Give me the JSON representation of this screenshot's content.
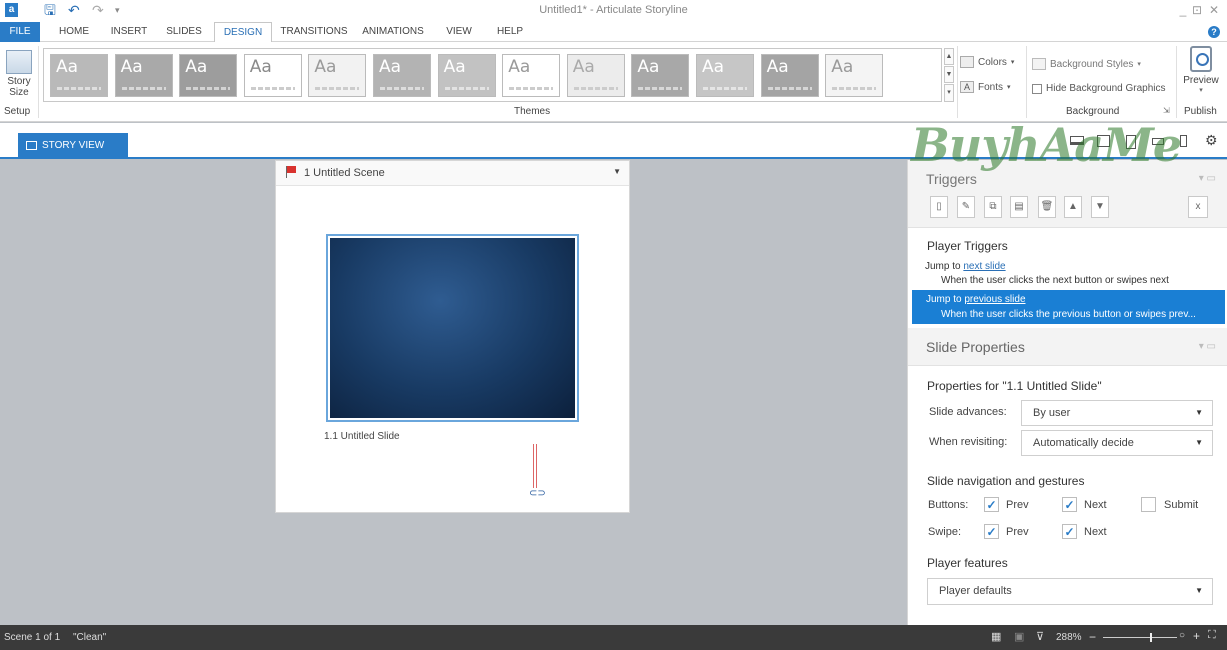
{
  "titlebar": {
    "app_icon": "a",
    "title": "Untitled1* - Articulate Storyline",
    "icons": [
      "save-icon",
      "undo-icon",
      "redo-icon",
      "customize-icon"
    ],
    "minimize": "_",
    "restore": "⊡",
    "close": "✕"
  },
  "tabs": [
    "FILE",
    "HOME",
    "INSERT",
    "SLIDES",
    "DESIGN",
    "TRANSITIONS",
    "ANIMATIONS",
    "VIEW",
    "HELP"
  ],
  "active_tab": "DESIGN",
  "help": "?",
  "ribbon": {
    "story_size": {
      "line1": "Story",
      "line2": "Size"
    },
    "groups": {
      "setup": "Setup",
      "themes": "Themes",
      "background": "Background",
      "publish": "Publish"
    },
    "theme_label": "Aa",
    "colors": "Colors",
    "fonts": "Fonts",
    "background_styles": "Background Styles",
    "hide_background_graphics": "Hide Background Graphics",
    "preview": "Preview",
    "themes": [
      {
        "bg": "#b9b9b9",
        "fg": "#ffffff",
        "style": "dark"
      },
      {
        "bg": "#a9a9a9",
        "fg": "#ffffff",
        "style": "dark"
      },
      {
        "bg": "#9d9d9d",
        "fg": "#ffffff",
        "style": "dark"
      },
      {
        "bg": "#ffffff",
        "fg": "#8a8a8a",
        "style": "light"
      },
      {
        "bg": "#f2f2f2",
        "fg": "#9a9a9a",
        "style": "light"
      },
      {
        "bg": "#b3b3b3",
        "fg": "#ffffff",
        "style": "dark"
      },
      {
        "bg": "#c2c2c2",
        "fg": "#ffffff",
        "style": "dark"
      },
      {
        "bg": "#ffffff",
        "fg": "#9a9a9a",
        "style": "light"
      },
      {
        "bg": "#ececec",
        "fg": "#aaaaaa",
        "style": "light"
      },
      {
        "bg": "#a8a8a8",
        "fg": "#ffffff",
        "style": "dark"
      },
      {
        "bg": "#c6c6c6",
        "fg": "#ffffff",
        "style": "dark"
      },
      {
        "bg": "#a4a4a4",
        "fg": "#ffffff",
        "style": "dark"
      },
      {
        "bg": "#f4f4f4",
        "fg": "#9a9a9a",
        "style": "light"
      }
    ]
  },
  "viewbar": {
    "story_view": "STORY VIEW",
    "device_icons": [
      "laptop-icon",
      "tablet-landscape-icon",
      "tablet-portrait-icon",
      "phone-landscape-icon",
      "phone-portrait-icon",
      "settings-icon"
    ]
  },
  "scene": {
    "title": "1 Untitled Scene",
    "slide_label": "1.1 Untitled Slide"
  },
  "triggers": {
    "title": "Triggers",
    "player_triggers": "Player Triggers",
    "trigger1": {
      "prefix": "Jump to ",
      "link": "next slide",
      "desc": "When the user clicks the next button or swipes next"
    },
    "trigger2": {
      "prefix": "Jump to ",
      "link": "previous slide",
      "desc": "When the user clicks the previous button or swipes prev..."
    }
  },
  "slide_properties": {
    "title": "Slide Properties",
    "properties_for": "Properties for \"1.1 Untitled Slide\"",
    "slide_advances_label": "Slide advances:",
    "slide_advances_value": "By user",
    "when_revisiting_label": "When revisiting:",
    "when_revisiting_value": "Automatically decide",
    "nav_title": "Slide navigation and gestures",
    "buttons_label": "Buttons:",
    "swipe_label": "Swipe:",
    "prev": "Prev",
    "next": "Next",
    "submit": "Submit",
    "checkboxes": {
      "buttons_prev": true,
      "buttons_next": true,
      "buttons_submit": false,
      "swipe_prev": true,
      "swipe_next": true
    },
    "player_features_title": "Player features",
    "player_features_value": "Player defaults"
  },
  "watermark": "BuyhAaMe",
  "status": {
    "scene": "Scene 1 of 1",
    "theme": "\"Clean\"",
    "zoom": "288%"
  },
  "colors": {
    "accent": "#2a7cc7",
    "selection": "#1a7fd4",
    "status_bar": "#3a3a3a"
  }
}
